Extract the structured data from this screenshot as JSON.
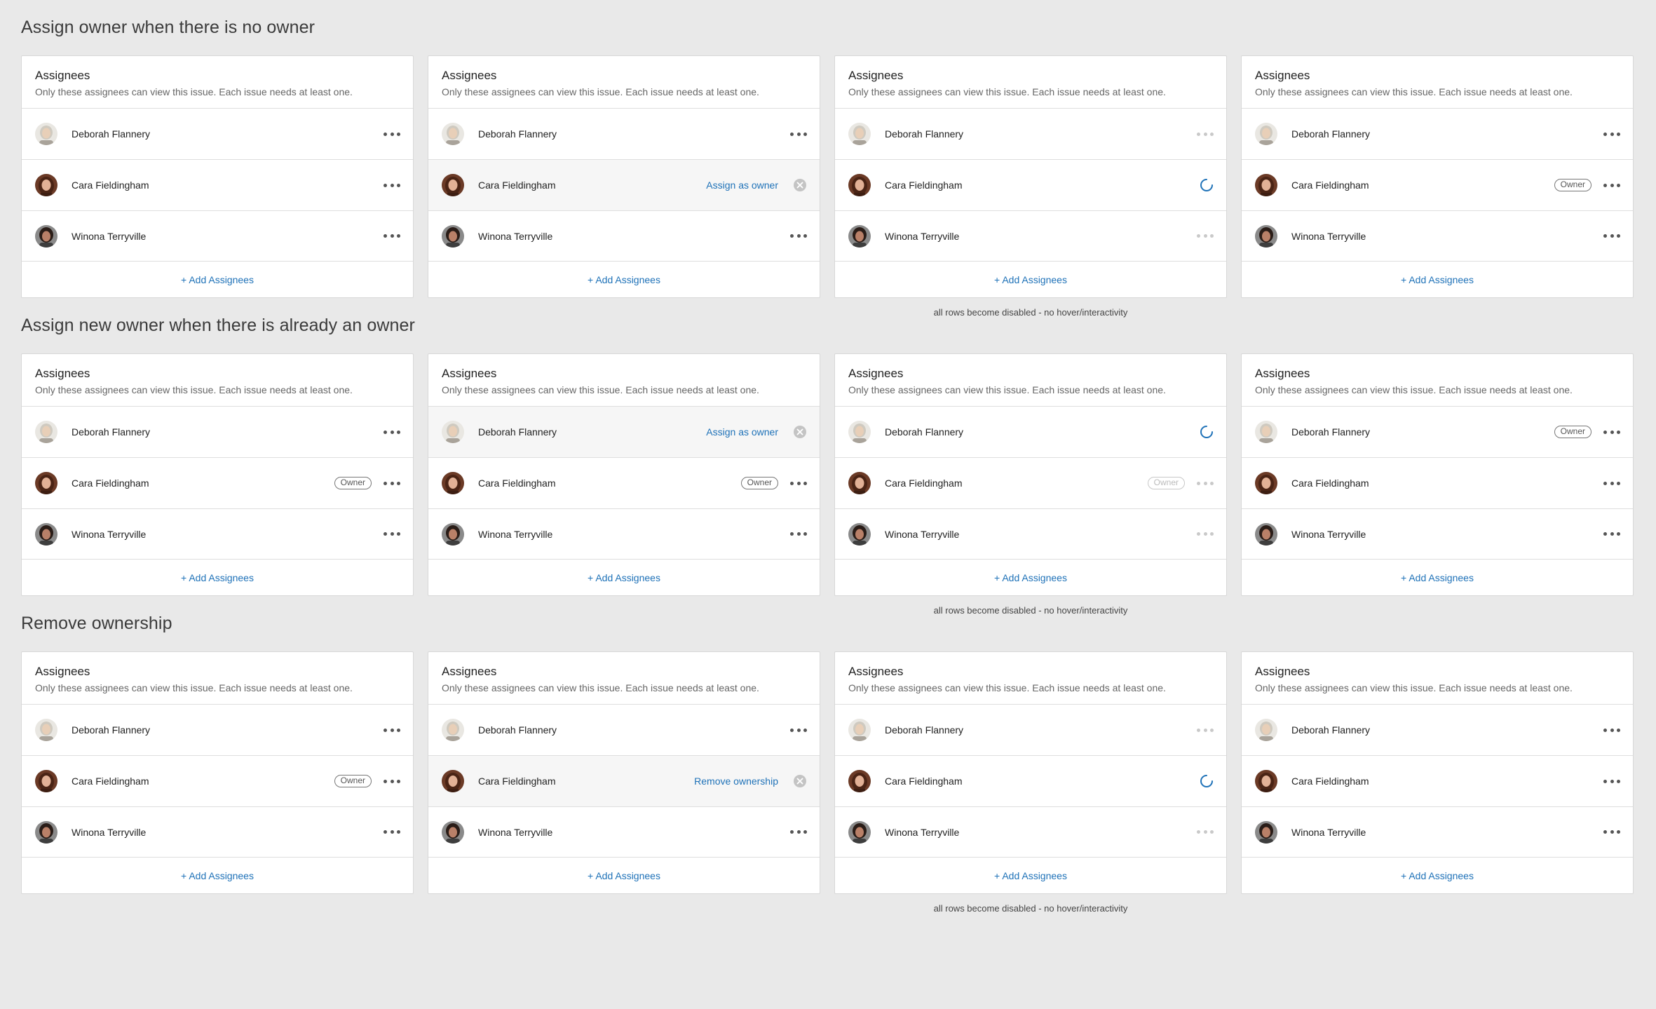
{
  "sections": [
    {
      "title": "Assign owner when there is no owner",
      "note": "all rows become disabled - no hover/interactivity",
      "cards": [
        {
          "rows": [
            {
              "name": "Deborah Flannery",
              "state": "default"
            },
            {
              "name": "Cara Fieldingham",
              "state": "default"
            },
            {
              "name": "Winona Terryville",
              "state": "default"
            }
          ]
        },
        {
          "rows": [
            {
              "name": "Deborah Flannery",
              "state": "default"
            },
            {
              "name": "Cara Fieldingham",
              "state": "hover-action",
              "action": "Assign as owner"
            },
            {
              "name": "Winona Terryville",
              "state": "default"
            }
          ]
        },
        {
          "rows": [
            {
              "name": "Deborah Flannery",
              "state": "disabled"
            },
            {
              "name": "Cara Fieldingham",
              "state": "loading"
            },
            {
              "name": "Winona Terryville",
              "state": "disabled"
            }
          ]
        },
        {
          "rows": [
            {
              "name": "Deborah Flannery",
              "state": "default"
            },
            {
              "name": "Cara Fieldingham",
              "state": "owner"
            },
            {
              "name": "Winona Terryville",
              "state": "default"
            }
          ]
        }
      ]
    },
    {
      "title": "Assign new owner when there is already an owner",
      "note": "all rows become disabled - no hover/interactivity",
      "cards": [
        {
          "rows": [
            {
              "name": "Deborah Flannery",
              "state": "default"
            },
            {
              "name": "Cara Fieldingham",
              "state": "owner"
            },
            {
              "name": "Winona Terryville",
              "state": "default"
            }
          ]
        },
        {
          "rows": [
            {
              "name": "Deborah Flannery",
              "state": "hover-action",
              "action": "Assign as owner"
            },
            {
              "name": "Cara Fieldingham",
              "state": "owner"
            },
            {
              "name": "Winona Terryville",
              "state": "default"
            }
          ]
        },
        {
          "rows": [
            {
              "name": "Deborah Flannery",
              "state": "loading"
            },
            {
              "name": "Cara Fieldingham",
              "state": "owner-disabled"
            },
            {
              "name": "Winona Terryville",
              "state": "disabled"
            }
          ]
        },
        {
          "rows": [
            {
              "name": "Deborah Flannery",
              "state": "owner"
            },
            {
              "name": "Cara Fieldingham",
              "state": "default"
            },
            {
              "name": "Winona Terryville",
              "state": "default"
            }
          ]
        }
      ]
    },
    {
      "title": "Remove ownership",
      "note": "all rows become disabled - no hover/interactivity",
      "cards": [
        {
          "rows": [
            {
              "name": "Deborah Flannery",
              "state": "default"
            },
            {
              "name": "Cara Fieldingham",
              "state": "owner"
            },
            {
              "name": "Winona Terryville",
              "state": "default"
            }
          ]
        },
        {
          "rows": [
            {
              "name": "Deborah Flannery",
              "state": "default"
            },
            {
              "name": "Cara Fieldingham",
              "state": "hover-action",
              "action": "Remove ownership"
            },
            {
              "name": "Winona Terryville",
              "state": "default"
            }
          ]
        },
        {
          "rows": [
            {
              "name": "Deborah Flannery",
              "state": "disabled"
            },
            {
              "name": "Cara Fieldingham",
              "state": "loading"
            },
            {
              "name": "Winona Terryville",
              "state": "disabled"
            }
          ]
        },
        {
          "rows": [
            {
              "name": "Deborah Flannery",
              "state": "default"
            },
            {
              "name": "Cara Fieldingham",
              "state": "default"
            },
            {
              "name": "Winona Terryville",
              "state": "default"
            }
          ]
        }
      ]
    }
  ],
  "card_title": "Assignees",
  "card_description": "Only these assignees can view this issue. Each issue needs at least one.",
  "owner_badge": "Owner",
  "add_assignees": "+ Add Assignees",
  "colors": {
    "background": "#e9e9e9",
    "link": "#1f72b8",
    "spinner": "#1f72b8"
  },
  "icons": {
    "menu": "more-horizontal-icon",
    "clear": "close-circle-icon",
    "loading": "spinner-icon"
  }
}
